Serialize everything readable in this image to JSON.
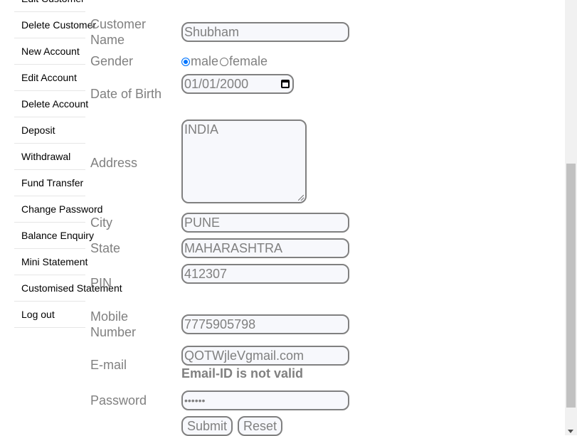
{
  "sidebar": {
    "items": [
      {
        "label": "Edit Customer"
      },
      {
        "label": "Delete Customer"
      },
      {
        "label": "New Account"
      },
      {
        "label": "Edit Account"
      },
      {
        "label": "Delete Account"
      },
      {
        "label": "Deposit"
      },
      {
        "label": "Withdrawal"
      },
      {
        "label": "Fund Transfer"
      },
      {
        "label": "Change Password"
      },
      {
        "label": "Balance Enquiry"
      },
      {
        "label": "Mini Statement"
      },
      {
        "label": "Customised Statement"
      },
      {
        "label": "Log out"
      }
    ]
  },
  "form": {
    "customer_name": {
      "label_line1": "Customer",
      "label_line2": "Name",
      "value": "Shubham"
    },
    "gender": {
      "label": "Gender",
      "options": [
        "male",
        "female"
      ],
      "selected": "male"
    },
    "dob": {
      "label": "Date of Birth",
      "value": "01/01/2000"
    },
    "address": {
      "label": "Address",
      "value": "INDIA"
    },
    "city": {
      "label": "City",
      "value": "PUNE"
    },
    "state": {
      "label": "State",
      "value": "MAHARASHTRA"
    },
    "pin": {
      "label": "PIN",
      "value": "412307"
    },
    "mobile": {
      "label_line1": "Mobile",
      "label_line2": "Number",
      "value": "7775905798"
    },
    "email": {
      "label": "E-mail",
      "value": "QOTWjleVgmail.com",
      "error": "Email-ID is not valid"
    },
    "password": {
      "label": "Password",
      "value": "••••••"
    },
    "submit_label": "Submit",
    "reset_label": "Reset"
  }
}
